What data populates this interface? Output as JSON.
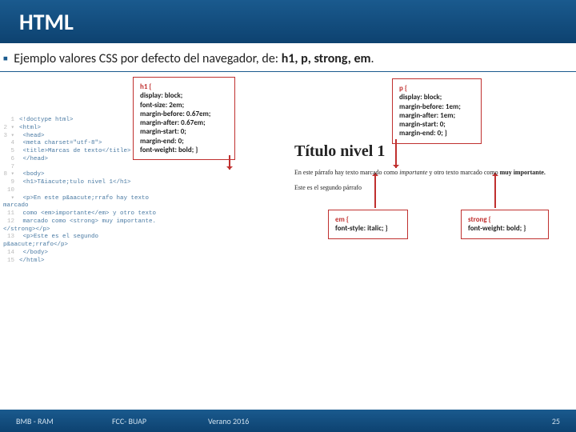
{
  "header": {
    "title": "HTML"
  },
  "subhead": {
    "bullet": "▪",
    "lead": "Ejemplo valores CSS por defecto del navegador, de: ",
    "targets": "h1, p, strong, em",
    "period": "."
  },
  "boxes": {
    "h1": {
      "selector": "h1 {",
      "lines": [
        "display: block;",
        "font-size: 2em;",
        "margin-before: 0.67em;",
        "margin-after: 0.67em;",
        "margin-start: 0;",
        "margin-end: 0;",
        "font-weight: bold; }"
      ]
    },
    "p": {
      "selector": "p {",
      "lines": [
        "display: block;",
        "margin-before: 1em;",
        "margin-after: 1em;",
        "margin-start: 0;",
        "margin-end: 0; }"
      ]
    },
    "em": {
      "selector": "em {",
      "lines": [
        "font-style: italic; }"
      ]
    },
    "strong": {
      "selector": "strong {",
      "lines": [
        "font-weight: bold; }"
      ]
    }
  },
  "source_lines": [
    "<!doctype html>",
    "<html>",
    "  <head>",
    "    <meta charset=\"utf-8\">",
    "    <title>Marcas de texto</title>",
    "  </head>",
    "",
    "  <body>",
    "    <h1>T&iacute;tulo nivel 1</h1>",
    "    <p>En este p&aacute;rrafo hay texto marcado",
    "    como <em>importante</em> y otro texto",
    "    marcado como <strong> muy importante.</strong></p>",
    "    <p>Este es el segundo p&aacute;rrafo</p>",
    "  </body>",
    "</html>"
  ],
  "render": {
    "h1": "Título nivel 1",
    "p1_a": "En este párrafo hay texto marcado como ",
    "p1_em": "importante",
    "p1_b": " y otro texto marcado como ",
    "p1_strong": "muy importante.",
    "p2": "Este es el segundo párrafo"
  },
  "footer": {
    "left": "BMB - RAM",
    "center1": "FCC- BUAP",
    "center2": "Verano 2016",
    "page": "25"
  }
}
